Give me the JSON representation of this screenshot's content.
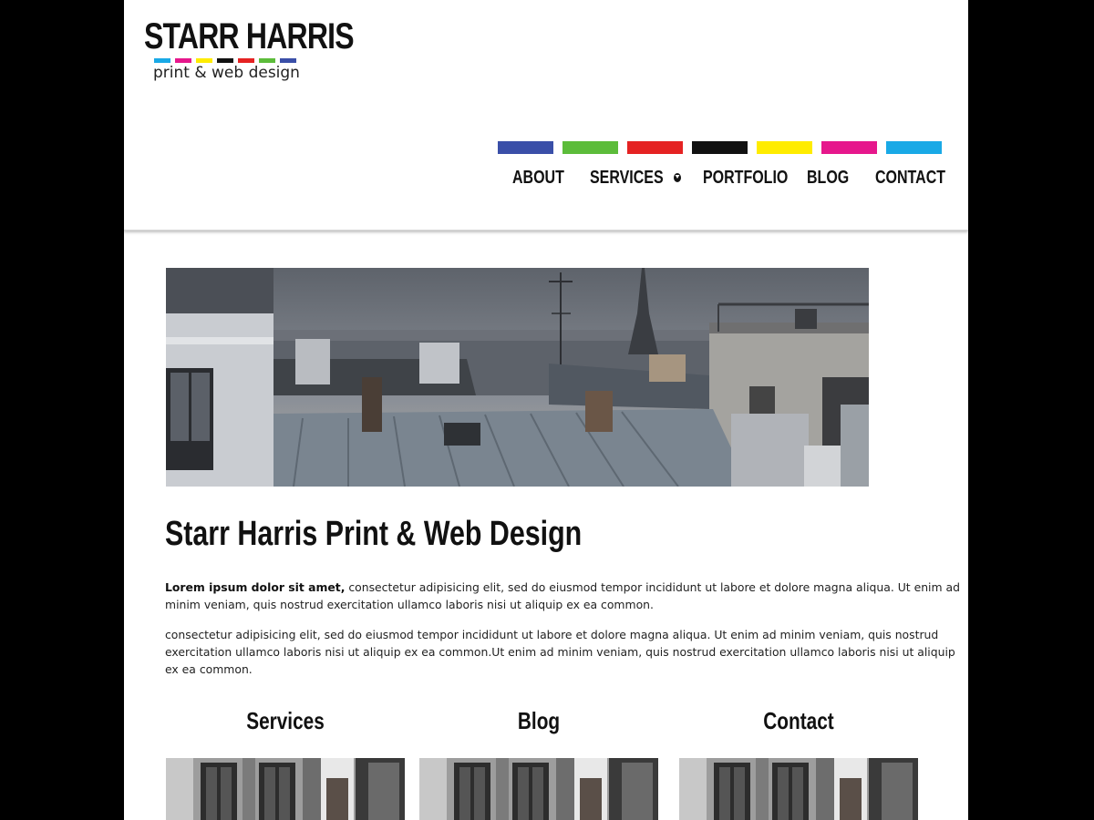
{
  "brand": {
    "name": "STARR HARRIS",
    "tagline": "print & web design",
    "logo_colors": [
      "#19a9e6",
      "#e6178c",
      "#ffec00",
      "#111111",
      "#e52222",
      "#5cbc3a",
      "#3a4fa8"
    ]
  },
  "nav": {
    "color_bars": [
      "#3a4fa8",
      "#5cbc3a",
      "#e52222",
      "#111111",
      "#ffec00",
      "#e6178c",
      "#19a9e6"
    ],
    "items": [
      {
        "label": "ABOUT"
      },
      {
        "label": "SERVICES",
        "icon": "chevron-down-icon"
      },
      {
        "label": "PORTFOLIO"
      },
      {
        "label": "BLOG"
      },
      {
        "label": "CONTACT"
      }
    ]
  },
  "hero": {
    "image": "paris-rooftops-eiffel-tower-photo"
  },
  "main": {
    "title": "Starr Harris Print & Web Design",
    "intro_bold": "Lorem ipsum dolor sit amet,",
    "intro_rest": " consectetur adipisicing elit, sed do eiusmod tempor incididunt ut labore et dolore magna aliqua. Ut enim ad minim veniam, quis nostrud exercitation ullamco laboris nisi ut aliquip ex ea common.",
    "paragraph2": "consectetur adipisicing elit, sed do eiusmod tempor incididunt ut labore et dolore magna aliqua. Ut enim ad minim veniam, quis nostrud exercitation ullamco laboris nisi ut aliquip ex ea common.Ut enim ad minim veniam, quis nostrud exercitation ullamco laboris nisi ut aliquip ex ea common."
  },
  "cards": [
    {
      "title": "Services",
      "image": "building-facade-photo"
    },
    {
      "title": "Blog",
      "image": "building-facade-photo"
    },
    {
      "title": "Contact",
      "image": "building-facade-photo"
    }
  ]
}
